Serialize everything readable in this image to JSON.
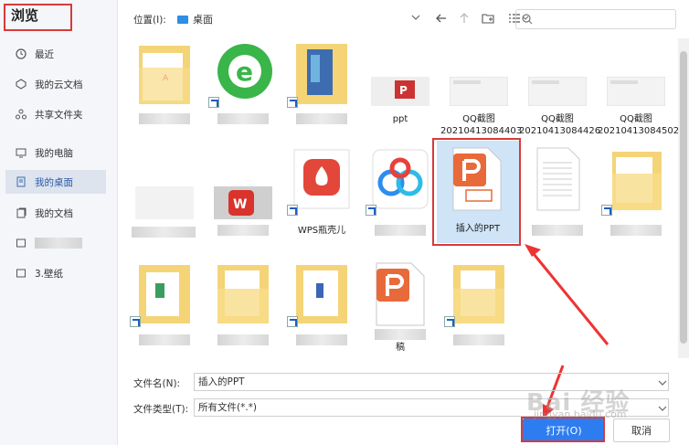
{
  "sidebar": {
    "title": "浏览",
    "items": [
      {
        "label": "最近",
        "icon": "clock-icon"
      },
      {
        "label": "我的云文档",
        "icon": "cloud-icon"
      },
      {
        "label": "共享文件夹",
        "icon": "share-icon"
      },
      {
        "label": "我的电脑",
        "icon": "computer-icon"
      },
      {
        "label": "我的桌面",
        "icon": "desktop-icon",
        "active": true
      },
      {
        "label": "我的文档",
        "icon": "document-icon"
      },
      {
        "label": "",
        "icon": "folder-icon"
      },
      {
        "label": "3.壁纸",
        "icon": "folder-icon"
      }
    ]
  },
  "toolbar": {
    "location_label": "位置(I):",
    "location_value": "桌面",
    "search_placeholder": ""
  },
  "files": {
    "row1": [
      "",
      "",
      "",
      "ppt",
      "QQ截图 20210413084403",
      "QQ截图 20210413084426",
      "QQ截图 20210413084502"
    ],
    "row2": [
      "",
      "",
      "WPS瓶壳儿",
      "",
      "插入的PPT",
      "",
      ""
    ],
    "row3": [
      "",
      "",
      "",
      "",
      "稿",
      ""
    ]
  },
  "bottom": {
    "filename_label": "文件名(N):",
    "filename_value": "插入的PPT",
    "filetype_label": "文件类型(T):",
    "filetype_value": "所有文件(*.*)",
    "open_label": "打开(O)",
    "cancel_label": "取消"
  },
  "watermark": {
    "text": "Bai 经验",
    "sub": "jingyan.baidu.com"
  },
  "colors": {
    "accent": "#2d7df0",
    "highlight": "#d93a3a",
    "wps_red": "#d9332b",
    "ppt_orange": "#e86a3a"
  }
}
